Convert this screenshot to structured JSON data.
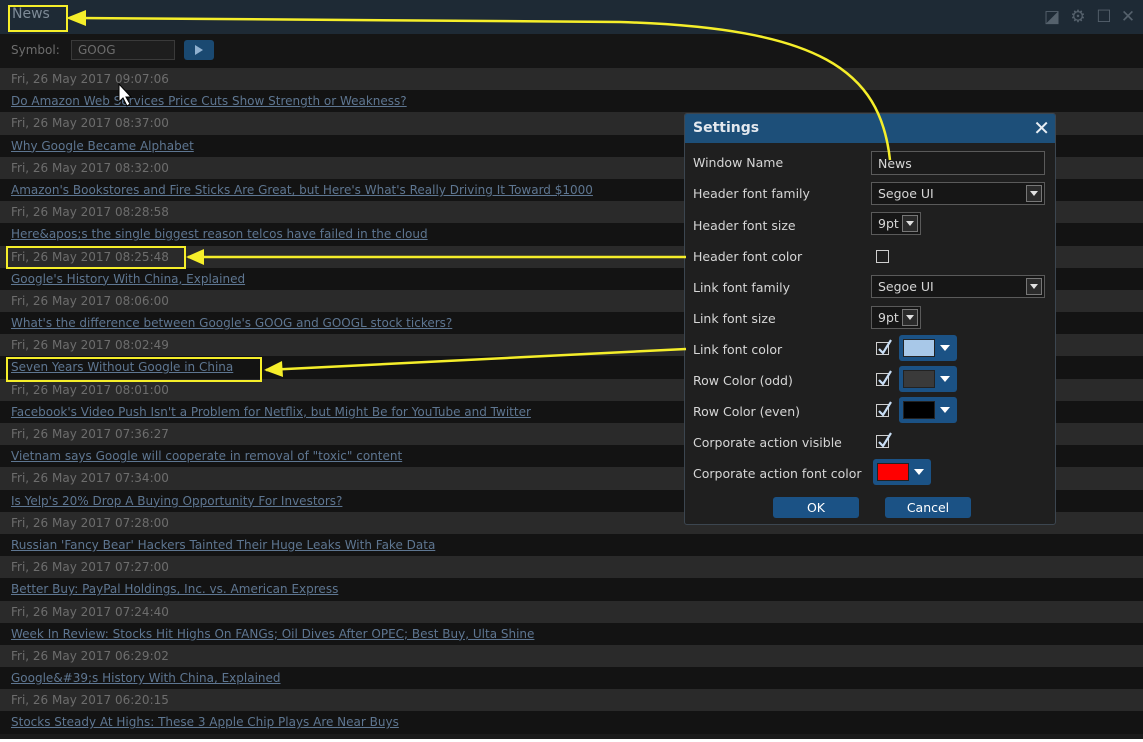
{
  "window": {
    "title": "News",
    "controls": [
      "◪",
      "⚙",
      "☐",
      "✕"
    ]
  },
  "toolbar": {
    "symbol_label": "Symbol:",
    "symbol_value": "GOOG"
  },
  "news": [
    {
      "type": "date",
      "text": "Fri, 26 May 2017 09:07:06"
    },
    {
      "type": "link",
      "text": "Do Amazon Web Services Price Cuts Show Strength or Weakness?"
    },
    {
      "type": "date",
      "text": "Fri, 26 May 2017 08:37:00"
    },
    {
      "type": "link",
      "text": "Why Google Became Alphabet"
    },
    {
      "type": "date",
      "text": "Fri, 26 May 2017 08:32:00"
    },
    {
      "type": "link",
      "text": "Amazon's Bookstores and Fire Sticks Are Great, but Here's What's Really Driving It Toward $1000"
    },
    {
      "type": "date",
      "text": "Fri, 26 May 2017 08:28:58"
    },
    {
      "type": "link",
      "text": "Here&apos;s the single biggest reason telcos have failed in the cloud"
    },
    {
      "type": "date",
      "text": "Fri, 26 May 2017 08:25:48"
    },
    {
      "type": "link",
      "text": "Google's History With China, Explained"
    },
    {
      "type": "date",
      "text": "Fri, 26 May 2017 08:06:00"
    },
    {
      "type": "link",
      "text": "What's the difference between Google's GOOG and GOOGL stock tickers?"
    },
    {
      "type": "date",
      "text": "Fri, 26 May 2017 08:02:49"
    },
    {
      "type": "link",
      "text": "Seven Years Without Google in China"
    },
    {
      "type": "date",
      "text": "Fri, 26 May 2017 08:01:00"
    },
    {
      "type": "link",
      "text": "Facebook's Video Push Isn't a Problem for Netflix, but Might Be for YouTube and Twitter"
    },
    {
      "type": "date",
      "text": "Fri, 26 May 2017 07:36:27"
    },
    {
      "type": "link",
      "text": "Vietnam says Google will cooperate in removal of \"toxic\" content"
    },
    {
      "type": "date",
      "text": "Fri, 26 May 2017 07:34:00"
    },
    {
      "type": "link",
      "text": "Is Yelp's 20% Drop A Buying Opportunity For Investors?"
    },
    {
      "type": "date",
      "text": "Fri, 26 May 2017 07:28:00"
    },
    {
      "type": "link",
      "text": "Russian 'Fancy Bear' Hackers Tainted Their Huge Leaks With Fake Data"
    },
    {
      "type": "date",
      "text": "Fri, 26 May 2017 07:27:00"
    },
    {
      "type": "link",
      "text": "Better Buy: PayPal Holdings, Inc. vs. American Express"
    },
    {
      "type": "date",
      "text": "Fri, 26 May 2017 07:24:40"
    },
    {
      "type": "link",
      "text": "Week In Review: Stocks Hit Highs On FANGs; Oil Dives After OPEC; Best Buy, Ulta Shine"
    },
    {
      "type": "date",
      "text": "Fri, 26 May 2017 06:29:02"
    },
    {
      "type": "link",
      "text": "Google&#39;s History With China, Explained"
    },
    {
      "type": "date",
      "text": "Fri, 26 May 2017 06:20:15"
    },
    {
      "type": "link",
      "text": "Stocks Steady At Highs: These 3 Apple Chip Plays Are Near Buys"
    }
  ],
  "settings": {
    "title": "Settings",
    "close": "✕",
    "window_name_label": "Window Name",
    "window_name_value": "News",
    "header_font_family_label": "Header font family",
    "header_font_family_value": "Segoe UI",
    "header_font_size_label": "Header font size",
    "header_font_size_value": "9pt",
    "header_font_color_label": "Header font color",
    "header_font_color_checked": false,
    "link_font_family_label": "Link font family",
    "link_font_family_value": "Segoe UI",
    "link_font_size_label": "Link font size",
    "link_font_size_value": "9pt",
    "link_font_color_label": "Link font color",
    "link_font_color_checked": true,
    "link_font_color": "#a8c8e8",
    "row_color_odd_label": "Row Color (odd)",
    "row_color_odd_checked": true,
    "row_color_odd": "#3a3a3a",
    "row_color_even_label": "Row Color (even)",
    "row_color_even_checked": true,
    "row_color_even": "#000000",
    "corporate_action_visible_label": "Corporate action visible",
    "corporate_action_visible_checked": true,
    "corporate_action_font_color_label": "Corporate action font color",
    "corporate_action_font_color": "#ff0000",
    "ok_label": "OK",
    "cancel_label": "Cancel"
  },
  "colors": {
    "accent": "#1b5285",
    "annotation": "#f5ee2a",
    "link": "#5e7691",
    "date": "#6d6d6d"
  }
}
